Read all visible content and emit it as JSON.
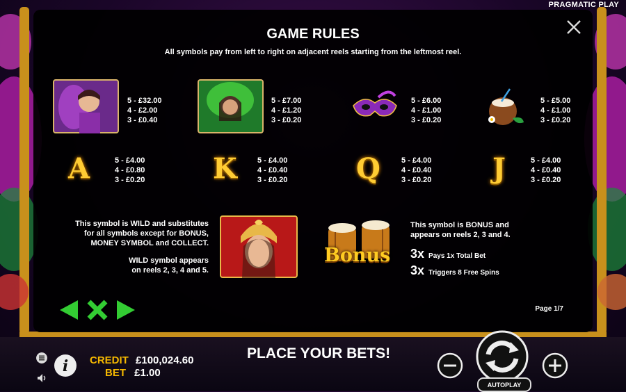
{
  "brand": "PRAGMATIC PLAY",
  "rules": {
    "title": "GAME RULES",
    "subtitle": "All symbols pay from left to right on adjacent reels starting from the leftmost reel.",
    "high_symbols": [
      {
        "icon": "purple-lady-symbol-icon",
        "pays": [
          "5 - £32.00",
          "4 - £2.00",
          "3 - £0.40"
        ]
      },
      {
        "icon": "green-lady-symbol-icon",
        "pays": [
          "5 - £7.00",
          "4 - £1.20",
          "3 - £0.20"
        ]
      },
      {
        "icon": "carnival-mask-icon",
        "pays": [
          "5 - £6.00",
          "4 - £1.00",
          "3 - £0.20"
        ]
      },
      {
        "icon": "coconut-drink-icon",
        "pays": [
          "5 - £5.00",
          "4 - £1.00",
          "3 - £0.20"
        ]
      }
    ],
    "low_symbols": [
      {
        "letter": "A",
        "pays": [
          "5 - £4.00",
          "4 - £0.80",
          "3 - £0.20"
        ]
      },
      {
        "letter": "K",
        "pays": [
          "5 - £4.00",
          "4 - £0.40",
          "3 - £0.20"
        ]
      },
      {
        "letter": "Q",
        "pays": [
          "5 - £4.00",
          "4 - £0.40",
          "3 - £0.20"
        ]
      },
      {
        "letter": "J",
        "pays": [
          "5 - £4.00",
          "4 - £0.40",
          "3 - £0.20"
        ]
      }
    ],
    "wild": {
      "line1": "This symbol is WILD and substitutes",
      "line2": "for all symbols except for BONUS,",
      "line3": "MONEY SYMBOL and COLLECT.",
      "line4": "WILD symbol appears",
      "line5": "on reels 2, 3, 4 and 5."
    },
    "bonus": {
      "label": "Bonus",
      "line1": "This symbol is BONUS and",
      "line2": "appears on reels 2, 3 and 4.",
      "pay1_count": "3x",
      "pay1_text": "Pays 1x Total Bet",
      "pay2_count": "3x",
      "pay2_text": "Triggers 8 Free Spins"
    },
    "page": "Page 1/7"
  },
  "footer": {
    "credit_label": "CREDIT",
    "credit_value": "£100,024.60",
    "bet_label": "BET",
    "bet_value": "£1.00",
    "message": "PLACE YOUR BETS!",
    "autoplay": "AUTOPLAY"
  },
  "colors": {
    "accent_gold": "#f5b800",
    "nav_green": "#33cc33",
    "panel_bg": "#000000"
  }
}
